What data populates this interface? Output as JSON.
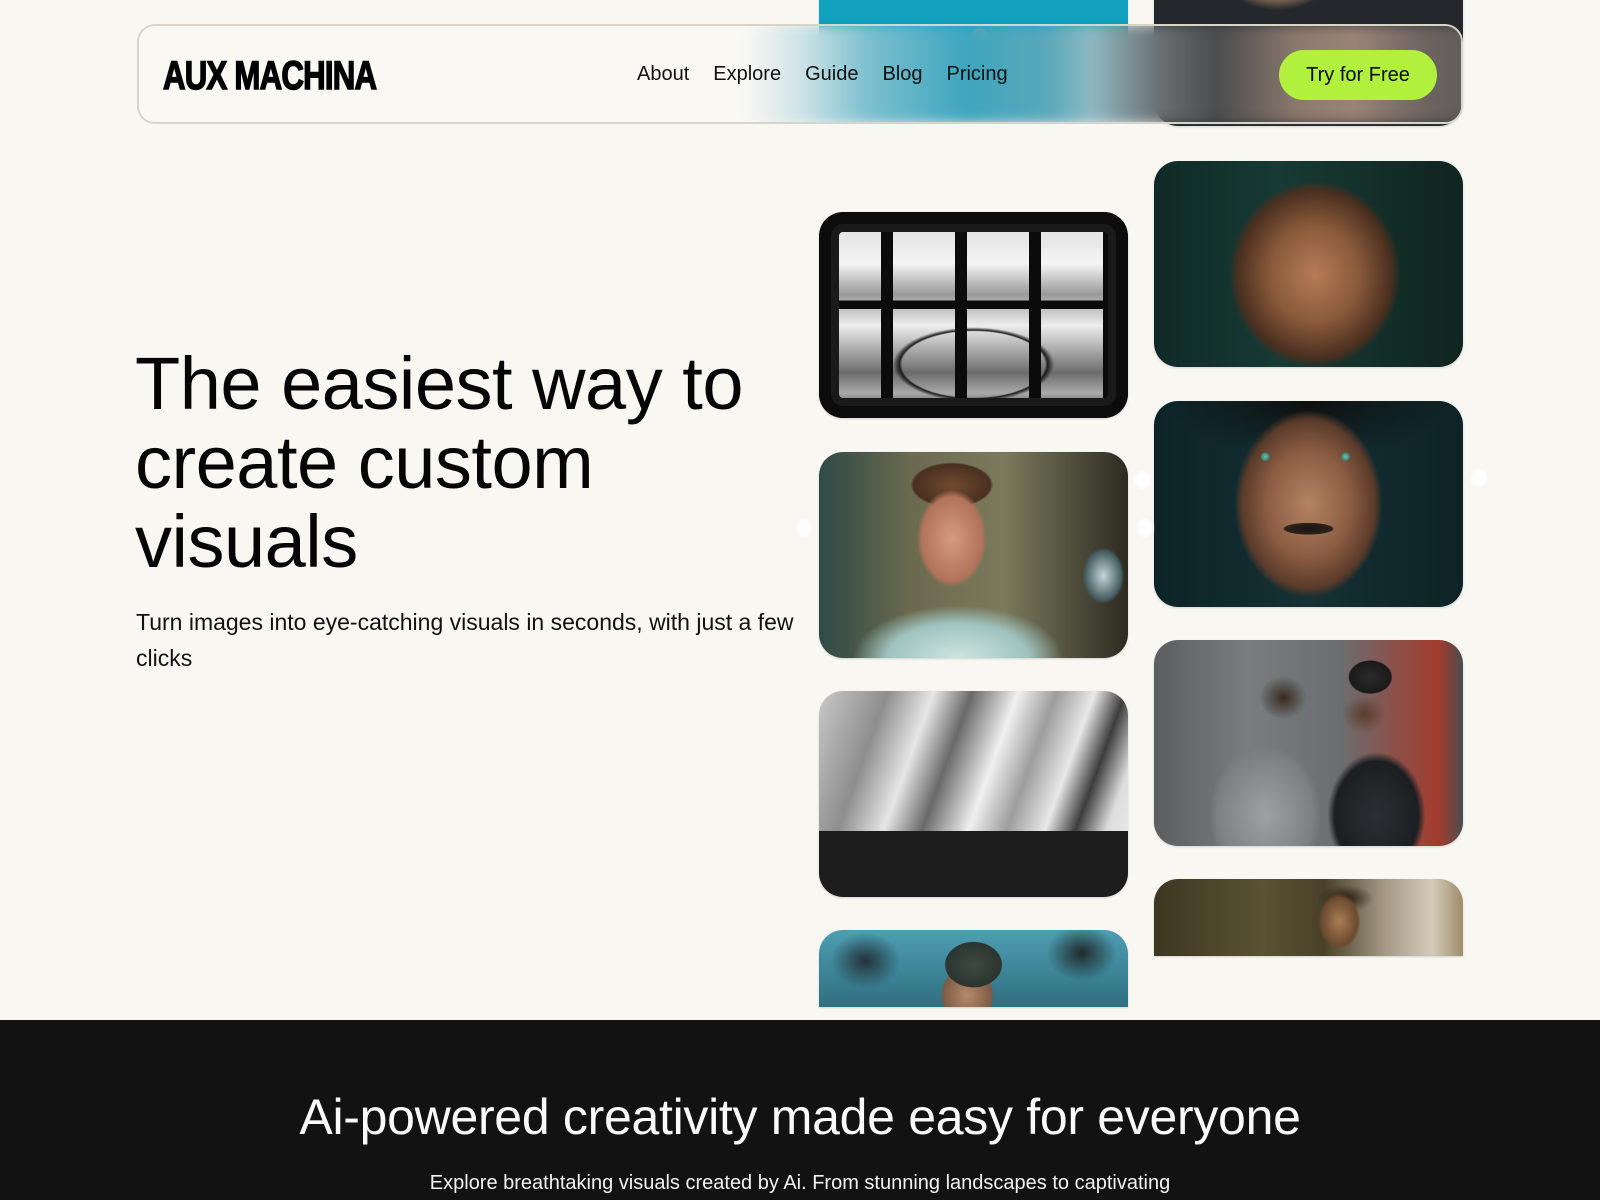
{
  "header": {
    "logo": "AUX MACHINA",
    "nav": [
      {
        "label": "About"
      },
      {
        "label": "Explore"
      },
      {
        "label": "Guide"
      },
      {
        "label": "Blog"
      },
      {
        "label": "Pricing"
      }
    ],
    "cta_label": "Try for Free",
    "cta_color": "#b2f03e"
  },
  "hero": {
    "title": "The easiest way to create custom visuals",
    "subtitle": "Turn images into eye-catching visuals in seconds, with just a few clicks"
  },
  "gallery": {
    "left_column": [
      {
        "subject": "hand-on-blue-background"
      },
      {
        "subject": "bridge-through-window-bw"
      },
      {
        "subject": "man-in-white-tshirt"
      },
      {
        "subject": "abstract-architecture-stairs-bw"
      },
      {
        "subject": "man-in-cap-at-dusk"
      }
    ],
    "right_column": [
      {
        "subject": "woman-portrait-closeup"
      },
      {
        "subject": "older-man-portrait"
      },
      {
        "subject": "man-green-eyes-portrait"
      },
      {
        "subject": "friends-with-camera-street"
      },
      {
        "subject": "man-against-weathered-wall"
      }
    ]
  },
  "section2": {
    "title": "Ai-powered creativity made easy for everyone",
    "subtitle": "Explore breathtaking visuals created by Ai. From stunning landscapes to captivating"
  },
  "colors": {
    "background": "#f8f7f2",
    "dark_section": "#121212",
    "accent": "#b2f03e"
  }
}
